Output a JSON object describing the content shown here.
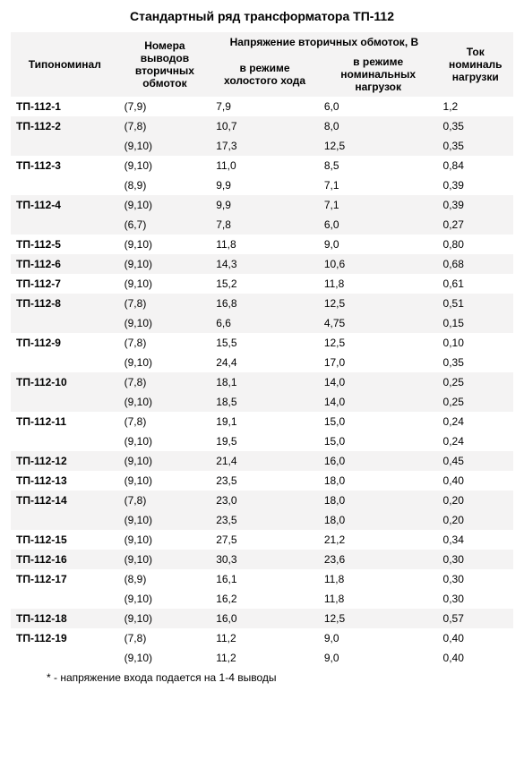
{
  "title": "Стандартный ряд трансформатора ТП-112",
  "headers": {
    "model": "Типономинал",
    "pins": "Номера выводов вторичных обмоток",
    "volt_group": "Напряжение вторичных обмоток, В",
    "volt_idle": "в режиме холостого хода",
    "volt_load": "в режиме номинальных нагрузок",
    "current": "Ток номиналь нагрузки"
  },
  "rows": [
    {
      "model": "ТП-112-1",
      "pins": "(7,9)",
      "idle": "7,9",
      "load": "6,0",
      "cur": "1,2"
    },
    {
      "model": "ТП-112-2",
      "pins": "(7,8)",
      "idle": "10,7",
      "load": "8,0",
      "cur": "0,35"
    },
    {
      "model": "",
      "pins": "(9,10)",
      "idle": "17,3",
      "load": "12,5",
      "cur": "0,35"
    },
    {
      "model": "ТП-112-3",
      "pins": "(9,10)",
      "idle": "11,0",
      "load": "8,5",
      "cur": "0,84"
    },
    {
      "model": "",
      "pins": "(8,9)",
      "idle": "9,9",
      "load": "7,1",
      "cur": "0,39"
    },
    {
      "model": "ТП-112-4",
      "pins": "(9,10)",
      "idle": "9,9",
      "load": "7,1",
      "cur": "0,39"
    },
    {
      "model": "",
      "pins": "(6,7)",
      "idle": "7,8",
      "load": "6,0",
      "cur": "0,27"
    },
    {
      "model": "ТП-112-5",
      "pins": "(9,10)",
      "idle": "11,8",
      "load": "9,0",
      "cur": "0,80"
    },
    {
      "model": "ТП-112-6",
      "pins": "(9,10)",
      "idle": "14,3",
      "load": "10,6",
      "cur": "0,68"
    },
    {
      "model": "ТП-112-7",
      "pins": "(9,10)",
      "idle": "15,2",
      "load": "11,8",
      "cur": "0,61"
    },
    {
      "model": "ТП-112-8",
      "pins": "(7,8)",
      "idle": "16,8",
      "load": "12,5",
      "cur": "0,51"
    },
    {
      "model": "",
      "pins": "(9,10)",
      "idle": "6,6",
      "load": "4,75",
      "cur": "0,15"
    },
    {
      "model": "ТП-112-9",
      "pins": "(7,8)",
      "idle": "15,5",
      "load": "12,5",
      "cur": "0,10"
    },
    {
      "model": "",
      "pins": "(9,10)",
      "idle": "24,4",
      "load": "17,0",
      "cur": "0,35"
    },
    {
      "model": "ТП-112-10",
      "pins": "(7,8)",
      "idle": "18,1",
      "load": "14,0",
      "cur": "0,25"
    },
    {
      "model": "",
      "pins": "(9,10)",
      "idle": "18,5",
      "load": "14,0",
      "cur": "0,25"
    },
    {
      "model": "ТП-112-11",
      "pins": "(7,8)",
      "idle": "19,1",
      "load": "15,0",
      "cur": "0,24"
    },
    {
      "model": "",
      "pins": "(9,10)",
      "idle": "19,5",
      "load": "15,0",
      "cur": "0,24"
    },
    {
      "model": "ТП-112-12",
      "pins": "(9,10)",
      "idle": "21,4",
      "load": "16,0",
      "cur": "0,45"
    },
    {
      "model": "ТП-112-13",
      "pins": "(9,10)",
      "idle": "23,5",
      "load": "18,0",
      "cur": "0,40"
    },
    {
      "model": "ТП-112-14",
      "pins": "(7,8)",
      "idle": "23,0",
      "load": "18,0",
      "cur": "0,20"
    },
    {
      "model": "",
      "pins": "(9,10)",
      "idle": "23,5",
      "load": "18,0",
      "cur": "0,20"
    },
    {
      "model": "ТП-112-15",
      "pins": "(9,10)",
      "idle": "27,5",
      "load": "21,2",
      "cur": "0,34"
    },
    {
      "model": "ТП-112-16",
      "pins": "(9,10)",
      "idle": "30,3",
      "load": "23,6",
      "cur": "0,30"
    },
    {
      "model": "ТП-112-17",
      "pins": "(8,9)",
      "idle": "16,1",
      "load": "11,8",
      "cur": "0,30"
    },
    {
      "model": "",
      "pins": "(9,10)",
      "idle": "16,2",
      "load": "11,8",
      "cur": "0,30"
    },
    {
      "model": "ТП-112-18",
      "pins": "(9,10)",
      "idle": "16,0",
      "load": "12,5",
      "cur": "0,57"
    },
    {
      "model": "ТП-112-19",
      "pins": "(7,8)",
      "idle": "11,2",
      "load": "9,0",
      "cur": "0,40"
    },
    {
      "model": "",
      "pins": "(9,10)",
      "idle": "11,2",
      "load": "9,0",
      "cur": "0,40"
    }
  ],
  "row_shade": [
    0,
    1,
    1,
    0,
    0,
    1,
    1,
    0,
    1,
    0,
    1,
    1,
    0,
    0,
    1,
    1,
    0,
    0,
    1,
    0,
    1,
    1,
    0,
    1,
    0,
    0,
    1,
    0,
    0
  ],
  "footnote": "* - напряжение входа подается на 1-4 выводы"
}
